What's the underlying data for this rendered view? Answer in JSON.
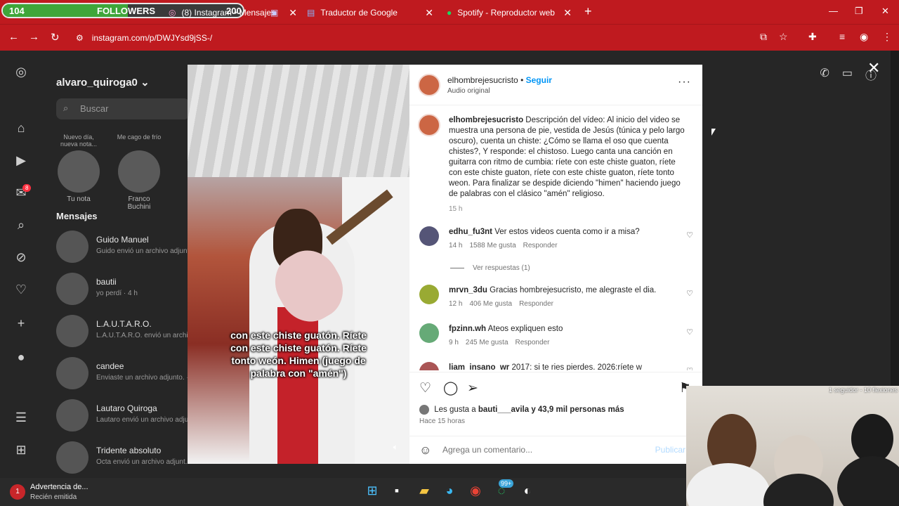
{
  "overlay": {
    "followers_current": "104",
    "followers_label": "FOLLOWERS",
    "followers_goal": "200",
    "followers_progress_fraction": 0.52,
    "webcam_label": "1 seguidor - 10 flexiones"
  },
  "browser": {
    "tabs": [
      {
        "label": "(8) Instagram • Mensajes",
        "close": "✕",
        "active": true
      },
      {
        "label": "Traductor de Google",
        "close": "✕",
        "active": false
      },
      {
        "label": "Spotify - Reproductor web: mú",
        "close": "✕",
        "active": false
      }
    ],
    "new_tab": "+",
    "url": "instagram.com/p/DWJYsd9jSS-/"
  },
  "instagram": {
    "username": "alvaro_quiroga0",
    "search_placeholder": "Buscar",
    "notes": [
      {
        "bubble": "Nuevo día, nueva nota...",
        "name": "Tu nota"
      },
      {
        "bubble": "Me cago de frío",
        "name": "Franco Buchini"
      }
    ],
    "messages_title": "Mensajes",
    "threads": [
      {
        "name": "Guido Manuel",
        "preview": "Guido envió un archivo adjunt..."
      },
      {
        "name": "bautii",
        "preview": "yo perdí · 4 h"
      },
      {
        "name": "L.A.U.T.A.R.O.",
        "preview": "L.A.U.T.A.R.O. envió un archivo..."
      },
      {
        "name": "candee",
        "preview": "Enviaste un archivo adjunto. ·"
      },
      {
        "name": "Lautaro Quiroga",
        "preview": "Lautaro envió un archivo adju..."
      },
      {
        "name": "Tridente absoluto",
        "preview": "Octa envió un archivo adjunt..."
      }
    ],
    "unread_badge": "8"
  },
  "post": {
    "author": "elhombrejesucristo",
    "follow": "Seguir",
    "audio": "Audio original",
    "caption_user": "elhombrejesucristo",
    "caption_text": "Descripción del vídeo: Al inicio del video se muestra una persona de pie, vestida de Jesús (túnica y pelo largo oscuro), cuenta un chiste: ¿Cómo se llama el oso que cuenta chistes?, Y responde: el chistoso. Luego canta una canción en guitarra con ritmo de cumbia: ríete con este chiste guaton, ríete con este chiste guaton, ríete con este chiste guaton, ríete tonto weon. Para finalizar se despide diciendo \"himen\" haciendo juego de palabras con el clásico \"amén\" religioso.",
    "caption_time": "15 h",
    "video_caption": "con este chiste guatón. Ríete con este chiste guatón. Ríete tonto weón. Himen (juego de palabra con \"amén\")",
    "comments": [
      {
        "user": "edhu_fu3nt",
        "text": "Ver estos videos cuenta como ir a misa?",
        "time": "14 h",
        "likes": "1588 Me gusta",
        "reply": "Responder"
      },
      {
        "user": "mrvn_3du",
        "text": "Gracias hombrejesucristo, me alegraste el dia.",
        "time": "12 h",
        "likes": "406 Me gusta",
        "reply": "Responder"
      },
      {
        "user": "fpzinn.wh",
        "text": "Ateos expliquen esto",
        "time": "9 h",
        "likes": "245 Me gusta",
        "reply": "Responder"
      },
      {
        "user": "liam_insano_wr",
        "text": "2017: si te ries pierdes. 2026:ríete w",
        "time": "",
        "likes": "",
        "reply": ""
      }
    ],
    "view_replies": "Ver respuestas (1)",
    "likes_prefix": "Les gusta a",
    "likes_user": "bauti___avila",
    "likes_suffix": "y 43,9 mil personas más",
    "posted_ago": "Hace 15 horas",
    "add_comment_placeholder": "Agrega un comentario...",
    "publish": "Publicar"
  },
  "taskbar": {
    "notification_title": "Advertencia de...",
    "notification_subtitle": "Recién emitida",
    "notification_badge": "1",
    "whatsapp_badge": "99+"
  }
}
